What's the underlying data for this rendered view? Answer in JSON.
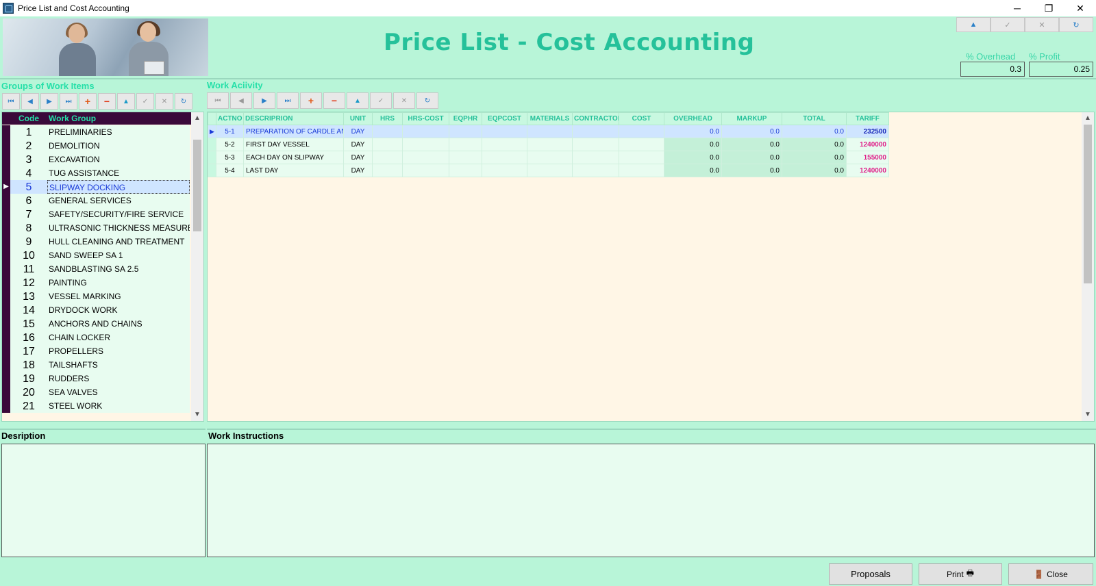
{
  "window": {
    "title": "Price List and Cost Accounting",
    "minimize": "─",
    "restore": "❐",
    "close": "✕"
  },
  "header": {
    "app_title": "Price List - Cost Accounting",
    "overhead_label": "% Overhead",
    "profit_label": "% Profit",
    "overhead_value": "0.3",
    "profit_value": "0.25",
    "nav": [
      "▲",
      "✓",
      "✕",
      "↻"
    ]
  },
  "groups": {
    "section_label": "Groups of Work Items",
    "toolbar": [
      "⏮",
      "◀",
      "▶",
      "⏭",
      "+",
      "−",
      "▲",
      "✓",
      "✕",
      "↻"
    ],
    "col_code": "Code",
    "col_group": "Work Group",
    "rows": [
      {
        "code": "1",
        "name": "PRELIMINARIES"
      },
      {
        "code": "2",
        "name": "DEMOLITION"
      },
      {
        "code": "3",
        "name": "EXCAVATION"
      },
      {
        "code": "4",
        "name": "TUG ASSISTANCE"
      },
      {
        "code": "5",
        "name": "SLIPWAY DOCKING"
      },
      {
        "code": "6",
        "name": "GENERAL SERVICES"
      },
      {
        "code": "7",
        "name": "SAFETY/SECURITY/FIRE SERVICE"
      },
      {
        "code": "8",
        "name": "ULTRASONIC THICKNESS MEASUREMENTS"
      },
      {
        "code": "9",
        "name": "HULL CLEANING AND TREATMENT"
      },
      {
        "code": "10",
        "name": "SAND SWEEP SA 1"
      },
      {
        "code": "11",
        "name": "SANDBLASTING SA 2.5"
      },
      {
        "code": "12",
        "name": "PAINTING"
      },
      {
        "code": "13",
        "name": "VESSEL MARKING"
      },
      {
        "code": "14",
        "name": "DRYDOCK WORK"
      },
      {
        "code": "15",
        "name": "ANCHORS AND CHAINS"
      },
      {
        "code": "16",
        "name": "CHAIN LOCKER"
      },
      {
        "code": "17",
        "name": "PROPELLERS"
      },
      {
        "code": "18",
        "name": "TAILSHAFTS"
      },
      {
        "code": "19",
        "name": "RUDDERS"
      },
      {
        "code": "20",
        "name": "SEA VALVES"
      },
      {
        "code": "21",
        "name": "STEEL WORK"
      }
    ],
    "selected_index": 4
  },
  "activity": {
    "section_label": "Work Aciivity",
    "toolbar": [
      "⏮",
      "◀",
      "▶",
      "⏭",
      "+",
      "−",
      "▲",
      "✓",
      "✕",
      "↻"
    ],
    "columns": [
      "ACTNO",
      "DESCRIPRION",
      "UNIT",
      "HRS",
      "HRS-COST",
      "EQPHR",
      "EQPCOST",
      "MATERIALS",
      "CONTRACTORS",
      "COST",
      "OVERHEAD",
      "MARKUP",
      "TOTAL",
      "TARIFF"
    ],
    "rows": [
      {
        "actno": "5-1",
        "desc": "PREPARATION OF CARDLE AND",
        "unit": "DAY",
        "overhead": "0.0",
        "markup": "0.0",
        "total": "0.0",
        "tariff": "232500"
      },
      {
        "actno": "5-2",
        "desc": "FIRST DAY VESSEL",
        "unit": "DAY",
        "overhead": "0.0",
        "markup": "0.0",
        "total": "0.0",
        "tariff": "1240000"
      },
      {
        "actno": "5-3",
        "desc": "EACH DAY ON SLIPWAY",
        "unit": "DAY",
        "overhead": "0.0",
        "markup": "0.0",
        "total": "0.0",
        "tariff": "155000"
      },
      {
        "actno": "5-4",
        "desc": "LAST DAY",
        "unit": "DAY",
        "overhead": "0.0",
        "markup": "0.0",
        "total": "0.0",
        "tariff": "1240000"
      }
    ]
  },
  "bottom": {
    "description_label": "Desription",
    "instructions_label": "Work Instructions"
  },
  "footer": {
    "proposals": "Proposals",
    "print": "Print",
    "close": "Close"
  }
}
